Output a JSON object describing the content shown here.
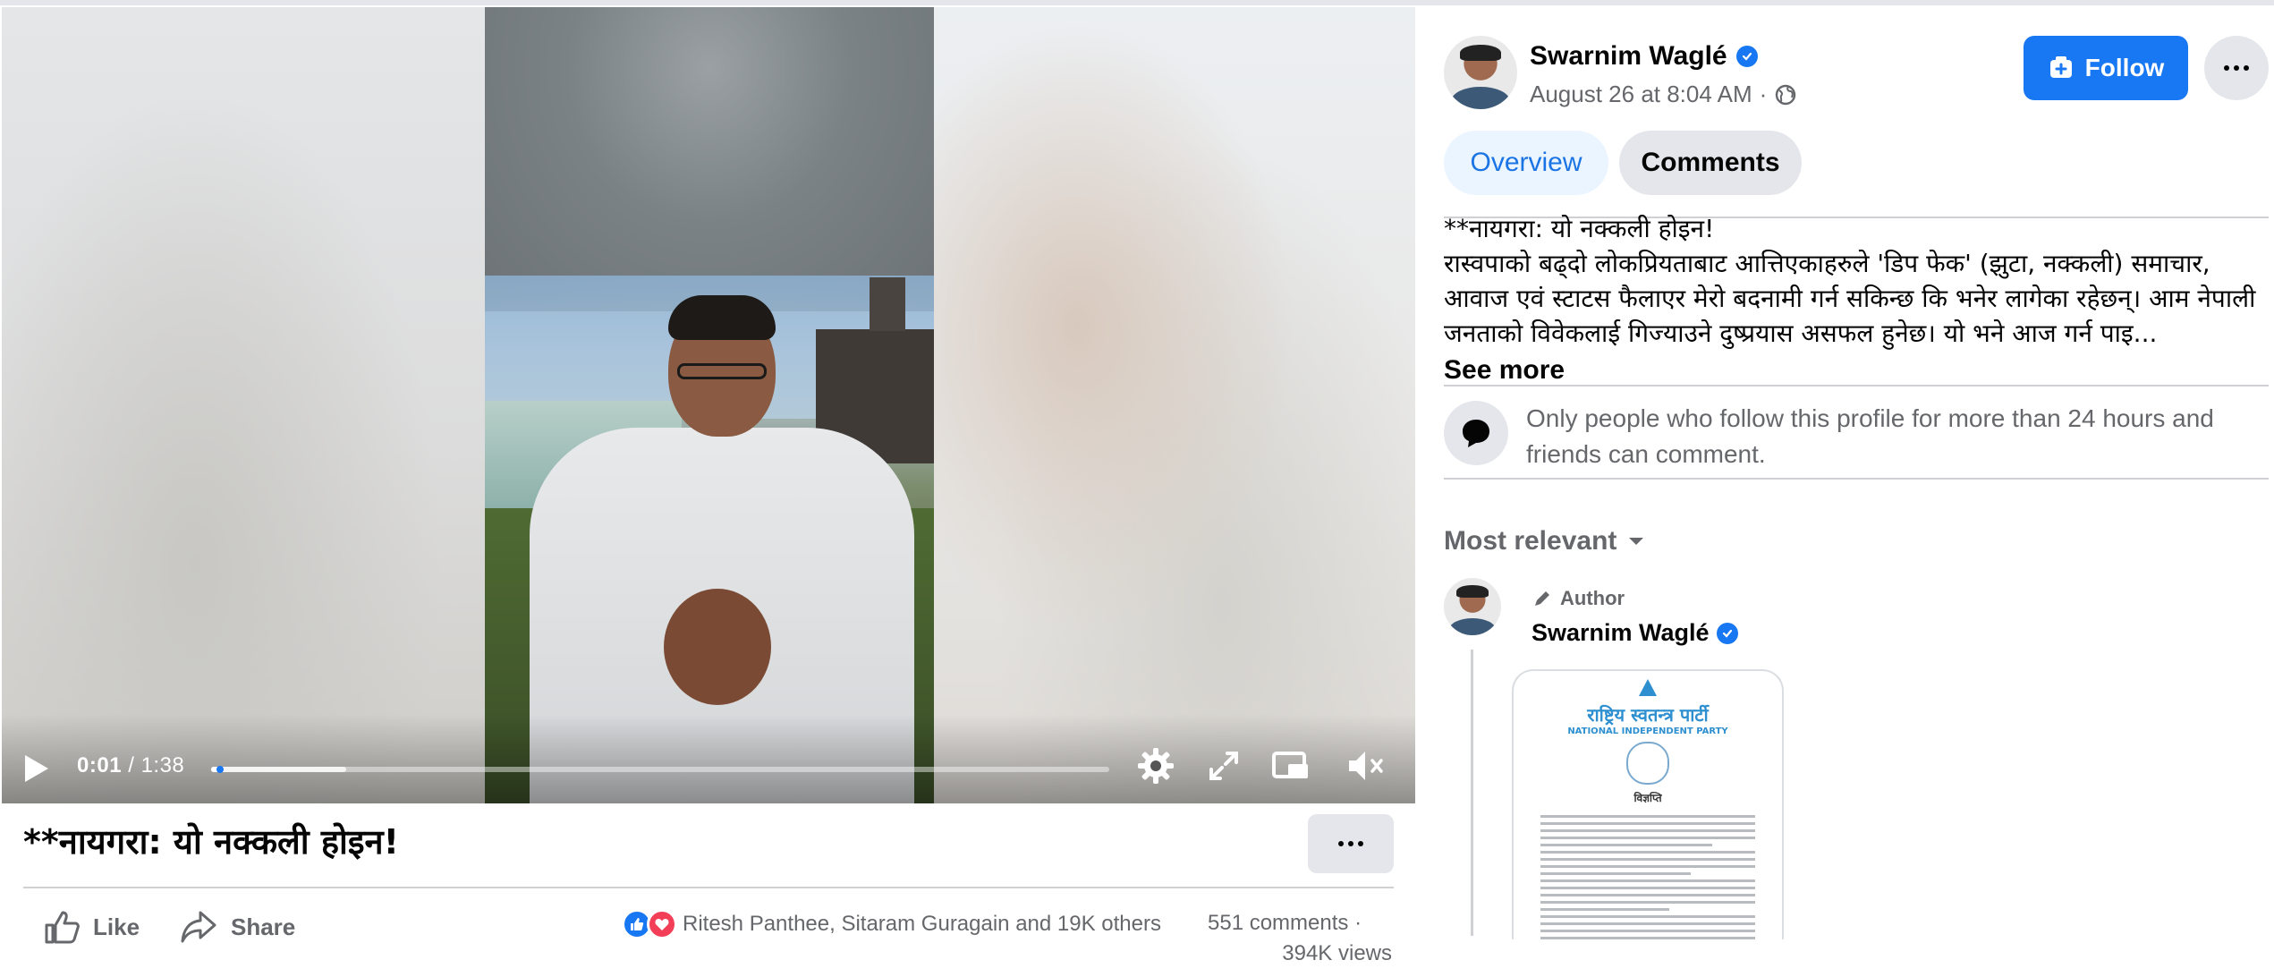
{
  "video": {
    "current_time": "0:01",
    "separator": "/",
    "duration": "1:38",
    "progress_fraction": 0.01
  },
  "post": {
    "title": "**नायगरा: यो नक्कली होइन!",
    "like_label": "Like",
    "share_label": "Share",
    "reactors": "Ritesh Panthee, Sitaram Guragain and 19K others",
    "comments_count": "551 comments",
    "views": "394K views"
  },
  "sidebar": {
    "author": "Swarnim Waglé",
    "date": "August 26 at 8:04 AM",
    "date_sep": "·",
    "follow_label": "Follow",
    "tabs": [
      {
        "label": "Overview",
        "active": true
      },
      {
        "label": "Comments",
        "active": false
      }
    ],
    "text_line1": "**नायगरा: यो नक्कली होइन!",
    "text_body": "रास्वपाको बढ्दो लोकप्रियताबाट आत्तिएकाहरुले 'डिप फेक' (झुटा, नक्कली) समाचार, आवाज एवं स्टाटस फैलाएर मेरो बदनामी गर्न सकिन्छ कि भनेर लागेका रहेछन्। आम नेपाली जनताको विवेकलाई गिज्याउने दुष्प्रयास असफल हुनेछ। यो भने आज गर्न पाइ...",
    "see_more": "See more",
    "notice": "Only people who follow this profile for more than 24 hours and friends can comment.",
    "sort_label": "Most relevant",
    "comment": {
      "tag": "Author",
      "name": "Swarnim Waglé",
      "doc_title": "राष्ट्रिय स्वतन्त्र पार्टी",
      "doc_subtitle": "NATIONAL INDEPENDENT PARTY",
      "doc_heading": "विज्ञप्ति"
    }
  },
  "colors": {
    "accent": "#1877f2",
    "secondary_text": "#65676b",
    "love": "#f33e58"
  }
}
